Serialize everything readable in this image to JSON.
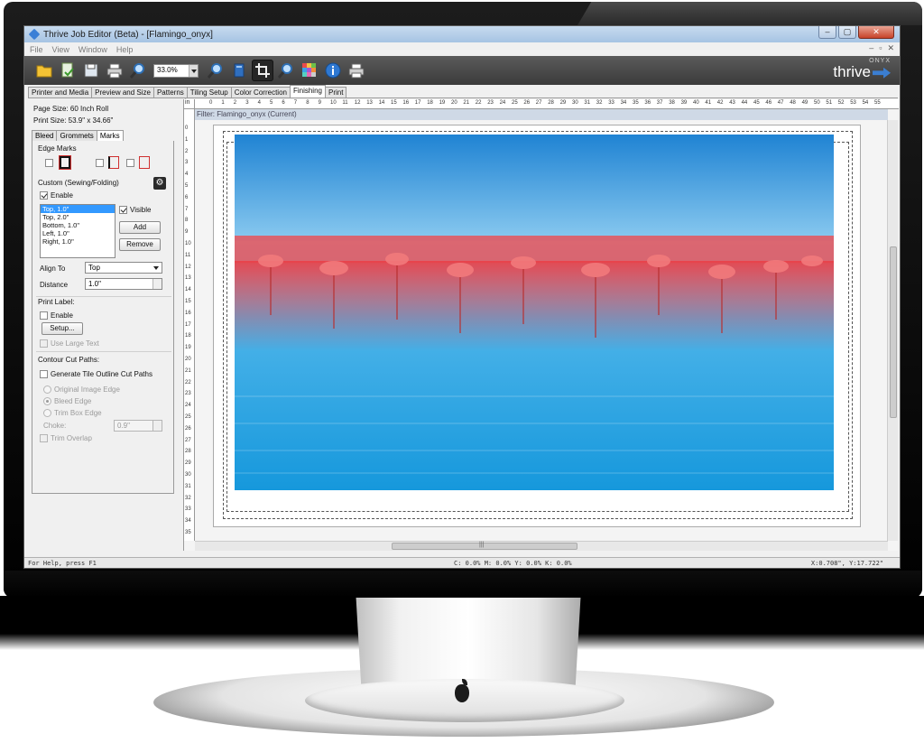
{
  "window": {
    "title": "Thrive Job Editor (Beta) - [Flamingo_onyx]",
    "controls": [
      "–",
      "▢",
      "✕"
    ]
  },
  "menu": [
    "File",
    "View",
    "Window",
    "Help"
  ],
  "menu_right": [
    "–",
    "▫",
    "✕"
  ],
  "toolbar": {
    "zoom": "33.0%",
    "brand_small": "ONYX",
    "brand_big": "thrive"
  },
  "tabs": [
    "Printer and Media",
    "Preview and Size",
    "Patterns",
    "Tiling Setup",
    "Color Correction",
    "Finishing",
    "Print"
  ],
  "info": {
    "page_size": "Page Size: 60 Inch Roll",
    "print_size": "Print Size: 53.9\" x 34.66\""
  },
  "subtabs": [
    "Bleed",
    "Grommets",
    "Marks"
  ],
  "marks": {
    "edge_marks_label": "Edge Marks",
    "custom_label": "Custom (Sewing/Folding)",
    "enable_label": "Enable",
    "list": [
      "Top, 1.0\"",
      "Top, 2.0\"",
      "Bottom, 1.0\"",
      "Left, 1.0\"",
      "Right, 1.0\""
    ],
    "visible_label": "Visible",
    "add_label": "Add",
    "remove_label": "Remove",
    "align_to_label": "Align To",
    "align_to_value": "Top",
    "distance_label": "Distance",
    "distance_value": "1.0\"",
    "print_label_heading": "Print Label:",
    "print_label_enable": "Enable",
    "setup_label": "Setup...",
    "large_text_label": "Use Large Text",
    "contour_heading": "Contour Cut Paths:",
    "generate_label": "Generate Tile Outline Cut Paths",
    "radio_original": "Original Image Edge",
    "radio_bleed": "Bleed Edge",
    "radio_trim": "Trim Box Edge",
    "choke_label": "Choke:",
    "choke_value": "0.9\"",
    "trim_overlap_label": "Trim Overlap"
  },
  "canvas": {
    "ruler_unit": "in",
    "ruler_top": [
      "0",
      "1",
      "2",
      "3",
      "4",
      "5",
      "6",
      "7",
      "8",
      "9",
      "10",
      "11",
      "12",
      "13",
      "14",
      "15",
      "16",
      "17",
      "18",
      "19",
      "20",
      "21",
      "22",
      "23",
      "24",
      "25",
      "26",
      "27",
      "28",
      "29",
      "30",
      "31",
      "32",
      "33",
      "34",
      "35",
      "36",
      "37",
      "38",
      "39",
      "40",
      "41",
      "42",
      "43",
      "44",
      "45",
      "46",
      "47",
      "48",
      "49",
      "50",
      "51",
      "52",
      "53",
      "54",
      "55"
    ],
    "ruler_left": [
      "0",
      "1",
      "2",
      "3",
      "4",
      "5",
      "6",
      "7",
      "8",
      "9",
      "10",
      "11",
      "12",
      "13",
      "14",
      "15",
      "16",
      "17",
      "18",
      "19",
      "20",
      "21",
      "22",
      "23",
      "24",
      "25",
      "26",
      "27",
      "28",
      "29",
      "30",
      "31",
      "32",
      "33",
      "34",
      "35"
    ],
    "filter_label": "Filter: Flamingo_onyx (Current)",
    "scroll_h_grip": "|||"
  },
  "status": {
    "help": "For Help, press F1",
    "cmyk": "C:  0.0% M:  0.0% Y:  0.0% K:  0.0%",
    "xy": "X:0.708\", Y:17.722\""
  }
}
